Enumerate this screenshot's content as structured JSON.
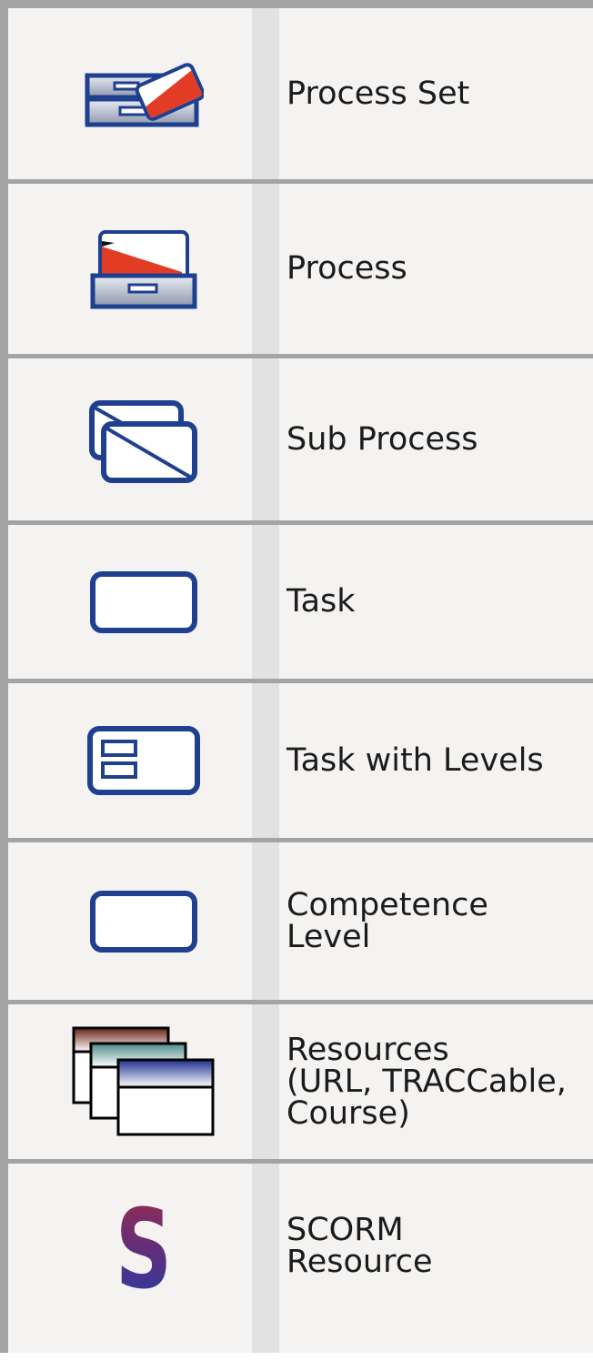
{
  "colors": {
    "icon_navy": "#1f3f8f",
    "icon_red": "#e33c24",
    "row_background": "#f4f3f2",
    "divider_stripe": "#e3e2e2",
    "border_gray": "#a4a4a4",
    "text": "#1b1b1b"
  },
  "legend": {
    "items": [
      {
        "icon": "process-set-icon",
        "label": "Process Set"
      },
      {
        "icon": "process-icon",
        "label": "Process"
      },
      {
        "icon": "sub-process-icon",
        "label": "Sub Process"
      },
      {
        "icon": "task-icon",
        "label": "Task"
      },
      {
        "icon": "task-with-levels-icon",
        "label": "Task with Levels"
      },
      {
        "icon": "competence-level-icon",
        "label": "Competence\nLevel"
      },
      {
        "icon": "resources-icon",
        "label": "Resources\n(URL, TRACCable,\nCourse)"
      },
      {
        "icon": "scorm-resource-icon",
        "label": "SCORM\nResource",
        "icon_glyph": "S"
      }
    ]
  }
}
